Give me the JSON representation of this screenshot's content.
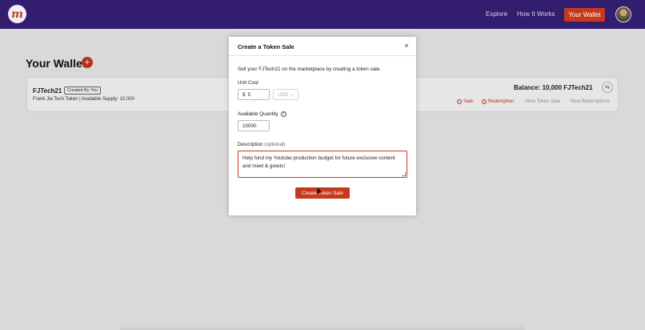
{
  "header": {
    "logo_letter": "m",
    "nav": {
      "explore": "Explore",
      "how_it_works": "How It Works",
      "your_wallet": "Your Wallet"
    }
  },
  "page": {
    "title": "Your Wallet",
    "add_symbol": "+"
  },
  "token_card": {
    "name": "FJTech21",
    "badge": "Created By You",
    "description": "Frank Jia Tech Token | Available Supply: 10,000",
    "balance": "Balance: 10,000 FJTech21",
    "actions": {
      "sale": "Sale",
      "redemption": "Redemption",
      "view_token_sale": "View Token Sale",
      "view_redemptions": "View Redemptions"
    }
  },
  "modal": {
    "title": "Create a Token Sale",
    "close": "×",
    "intro": "Sell your FJTech21 on the marketplace by creating a token sale.",
    "unit_cost_label": "Unit Cost",
    "currency_symbol": "$",
    "unit_cost_value": "5",
    "currency": "USD",
    "quantity_label": "Available Quantity",
    "quantity_value": "10000",
    "description_label": "Description",
    "description_optional": "(optional)",
    "description_value": "Help fund my Youtube production budget for future exclusive content and meet & greets!",
    "submit": "Create Token Sale"
  },
  "colors": {
    "header_bg": "#321d6e",
    "accent": "#c6391b"
  }
}
